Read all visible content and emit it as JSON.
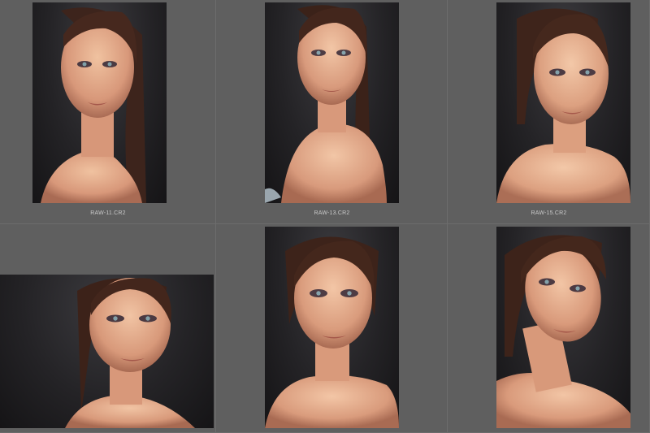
{
  "window": {
    "view": "grid"
  },
  "grid": {
    "thumbnails": [
      {
        "filename": "RAW-11.CR2",
        "selected": false
      },
      {
        "filename": "RAW-13.CR2",
        "selected": false
      },
      {
        "filename": "RAW-15.CR2",
        "selected": false
      },
      {
        "filename": "",
        "selected": false
      },
      {
        "filename": "",
        "selected": false
      },
      {
        "filename": "",
        "selected": false
      }
    ]
  },
  "colors": {
    "background": "#5e5e5e",
    "cell_border": "#6c6c6c",
    "caption": "#c9c9c9"
  }
}
